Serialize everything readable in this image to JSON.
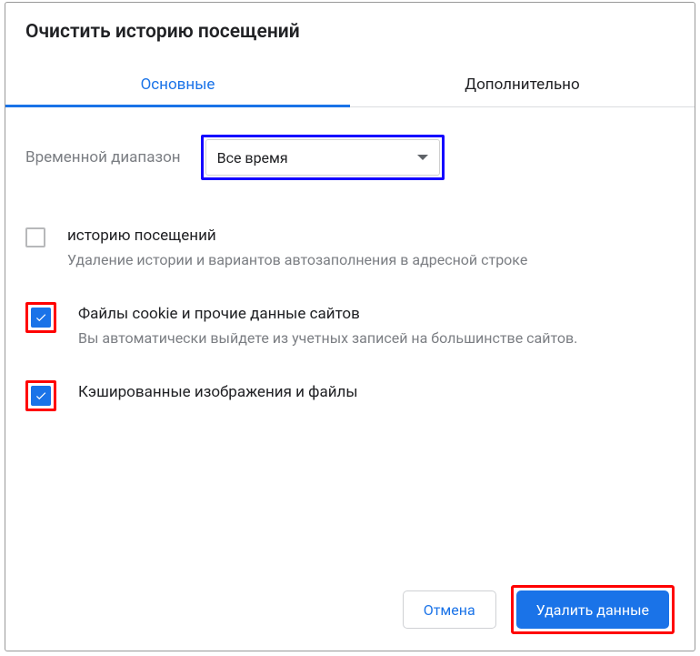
{
  "dialog": {
    "title": "Очистить историю посещений"
  },
  "tabs": {
    "basic": "Основные",
    "advanced": "Дополнительно",
    "active": "basic"
  },
  "time_range": {
    "label": "Временной диапазон",
    "selected": "Все время"
  },
  "options": [
    {
      "checked": false,
      "highlighted": false,
      "title": "историю посещений",
      "desc": "Удаление истории и вариантов автозаполнения в адресной строке"
    },
    {
      "checked": true,
      "highlighted": true,
      "title": "Файлы cookie и прочие данные сайтов",
      "desc": "Вы автоматически выйдете из учетных записей на большинстве сайтов."
    },
    {
      "checked": true,
      "highlighted": true,
      "title": "Кэшированные изображения и файлы",
      "desc": ""
    }
  ],
  "footer": {
    "cancel": "Отмена",
    "confirm": "Удалить данные"
  }
}
